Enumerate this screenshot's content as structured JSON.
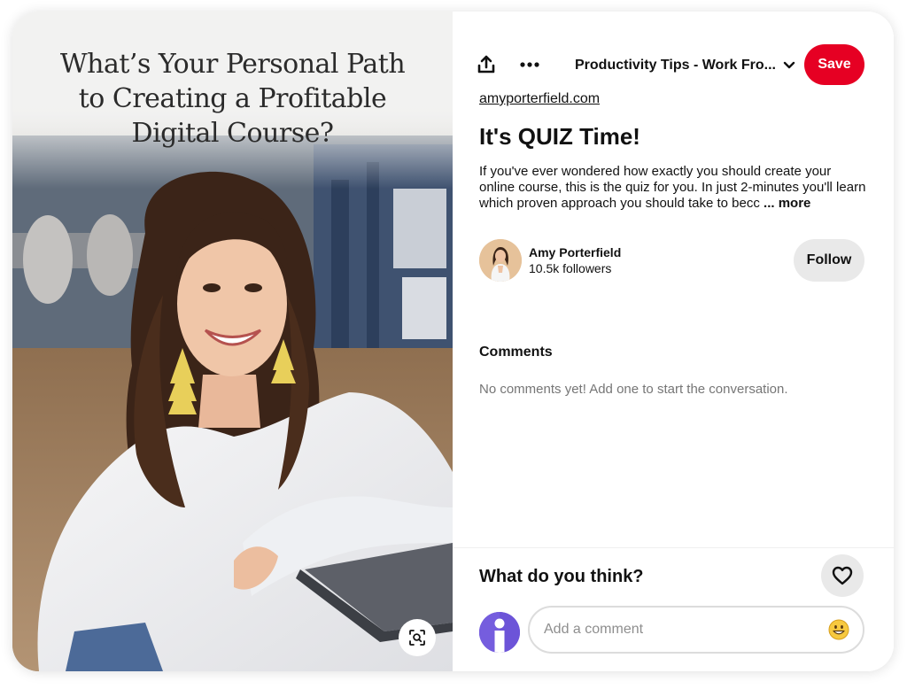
{
  "pin_image": {
    "headline_lines": [
      "What’s Your Personal Path",
      "to Creating a Profitable",
      "Digital Course?"
    ]
  },
  "toolbar": {
    "share_icon": "share-upload-icon",
    "more_icon": "more-dots-icon",
    "board_name": "Productivity Tips - Work Fro...",
    "board_chevron_icon": "chevron-down-icon",
    "save_label": "Save"
  },
  "pin": {
    "source": "amyporterfield.com",
    "title": "It's QUIZ Time!",
    "description": "If you've ever wondered how exactly you should create your online course, this is the quiz for you. In just 2-minutes you'll learn which proven approach you should take to becc",
    "more_label": "... more"
  },
  "creator": {
    "name": "Amy Porterfield",
    "followers": "10.5k followers",
    "follow_label": "Follow"
  },
  "comments": {
    "heading": "Comments",
    "empty_text": "No comments yet! Add one to start the conversation."
  },
  "footer": {
    "prompt": "What do you think?",
    "heart_icon": "heart-icon",
    "comment_placeholder": "Add a comment",
    "emoji_icon": "emoji-smile-icon"
  },
  "colors": {
    "save_red": "#e60023",
    "follow_gray": "#e9e9e9",
    "my_avatar_purple": "#6c54d8",
    "muted_text": "#767676"
  }
}
